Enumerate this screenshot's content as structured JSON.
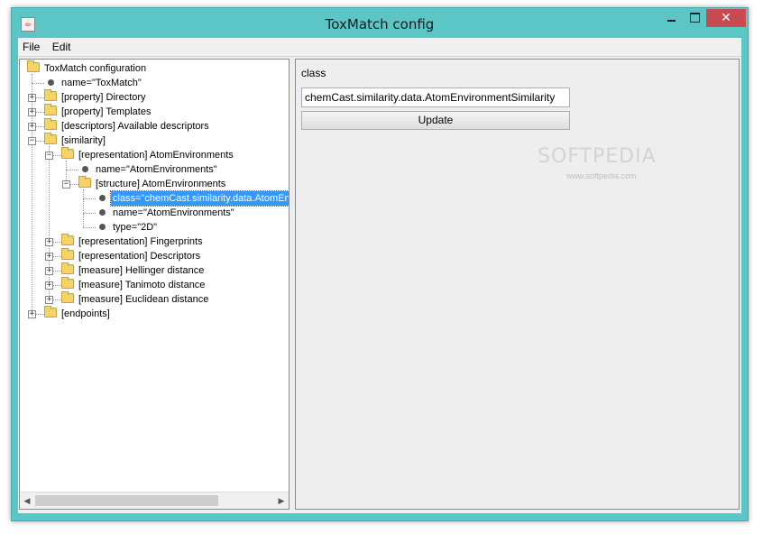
{
  "window": {
    "title": "ToxMatch config",
    "close_symbol": "✕"
  },
  "menu": {
    "items": [
      "File",
      "Edit"
    ]
  },
  "tree": {
    "nodes": [
      {
        "label": "ToxMatch configuration",
        "kind": "folder",
        "level": 0,
        "expander": "none"
      },
      {
        "label": "name=\"ToxMatch\"",
        "kind": "leaf",
        "level": 1,
        "expander": "none"
      },
      {
        "label": "[property] Directory",
        "kind": "folder",
        "level": 1,
        "expander": "+"
      },
      {
        "label": "[property] Templates",
        "kind": "folder",
        "level": 1,
        "expander": "+"
      },
      {
        "label": "[descriptors] Available descriptors",
        "kind": "folder",
        "level": 1,
        "expander": "+"
      },
      {
        "label": "[similarity]",
        "kind": "folder",
        "level": 1,
        "expander": "-"
      },
      {
        "label": "[representation] AtomEnvironments",
        "kind": "folder",
        "level": 2,
        "expander": "-"
      },
      {
        "label": "name=\"AtomEnvironments\"",
        "kind": "leaf",
        "level": 3,
        "expander": "none"
      },
      {
        "label": "[structure] AtomEnvironments",
        "kind": "folder",
        "level": 3,
        "expander": "-"
      },
      {
        "label": "class=\"chemCast.similarity.data.AtomEnvi",
        "kind": "leaf",
        "level": 4,
        "expander": "none",
        "selected": true
      },
      {
        "label": "name=\"AtomEnvironments\"",
        "kind": "leaf",
        "level": 4,
        "expander": "none"
      },
      {
        "label": "type=\"2D\"",
        "kind": "leaf",
        "level": 4,
        "expander": "none"
      },
      {
        "label": "[representation] Fingerprints",
        "kind": "folder",
        "level": 2,
        "expander": "+"
      },
      {
        "label": "[representation] Descriptors",
        "kind": "folder",
        "level": 2,
        "expander": "+"
      },
      {
        "label": "[measure] Hellinger distance",
        "kind": "folder",
        "level": 2,
        "expander": "+"
      },
      {
        "label": "[measure] Tanimoto distance",
        "kind": "folder",
        "level": 2,
        "expander": "+"
      },
      {
        "label": "[measure] Euclidean distance",
        "kind": "folder",
        "level": 2,
        "expander": "+"
      },
      {
        "label": "[endpoints]",
        "kind": "folder",
        "level": 1,
        "expander": "+"
      }
    ]
  },
  "editor": {
    "field_label": "class",
    "field_value": "chemCast.similarity.data.AtomEnvironmentSimilarity",
    "update_label": "Update"
  },
  "watermark": {
    "text": "SOFTPEDIA",
    "sub": "www.softpedia.com"
  },
  "colors": {
    "window_frame": "#5bc6c6",
    "close_button": "#c74b50",
    "selection": "#3399ff"
  }
}
